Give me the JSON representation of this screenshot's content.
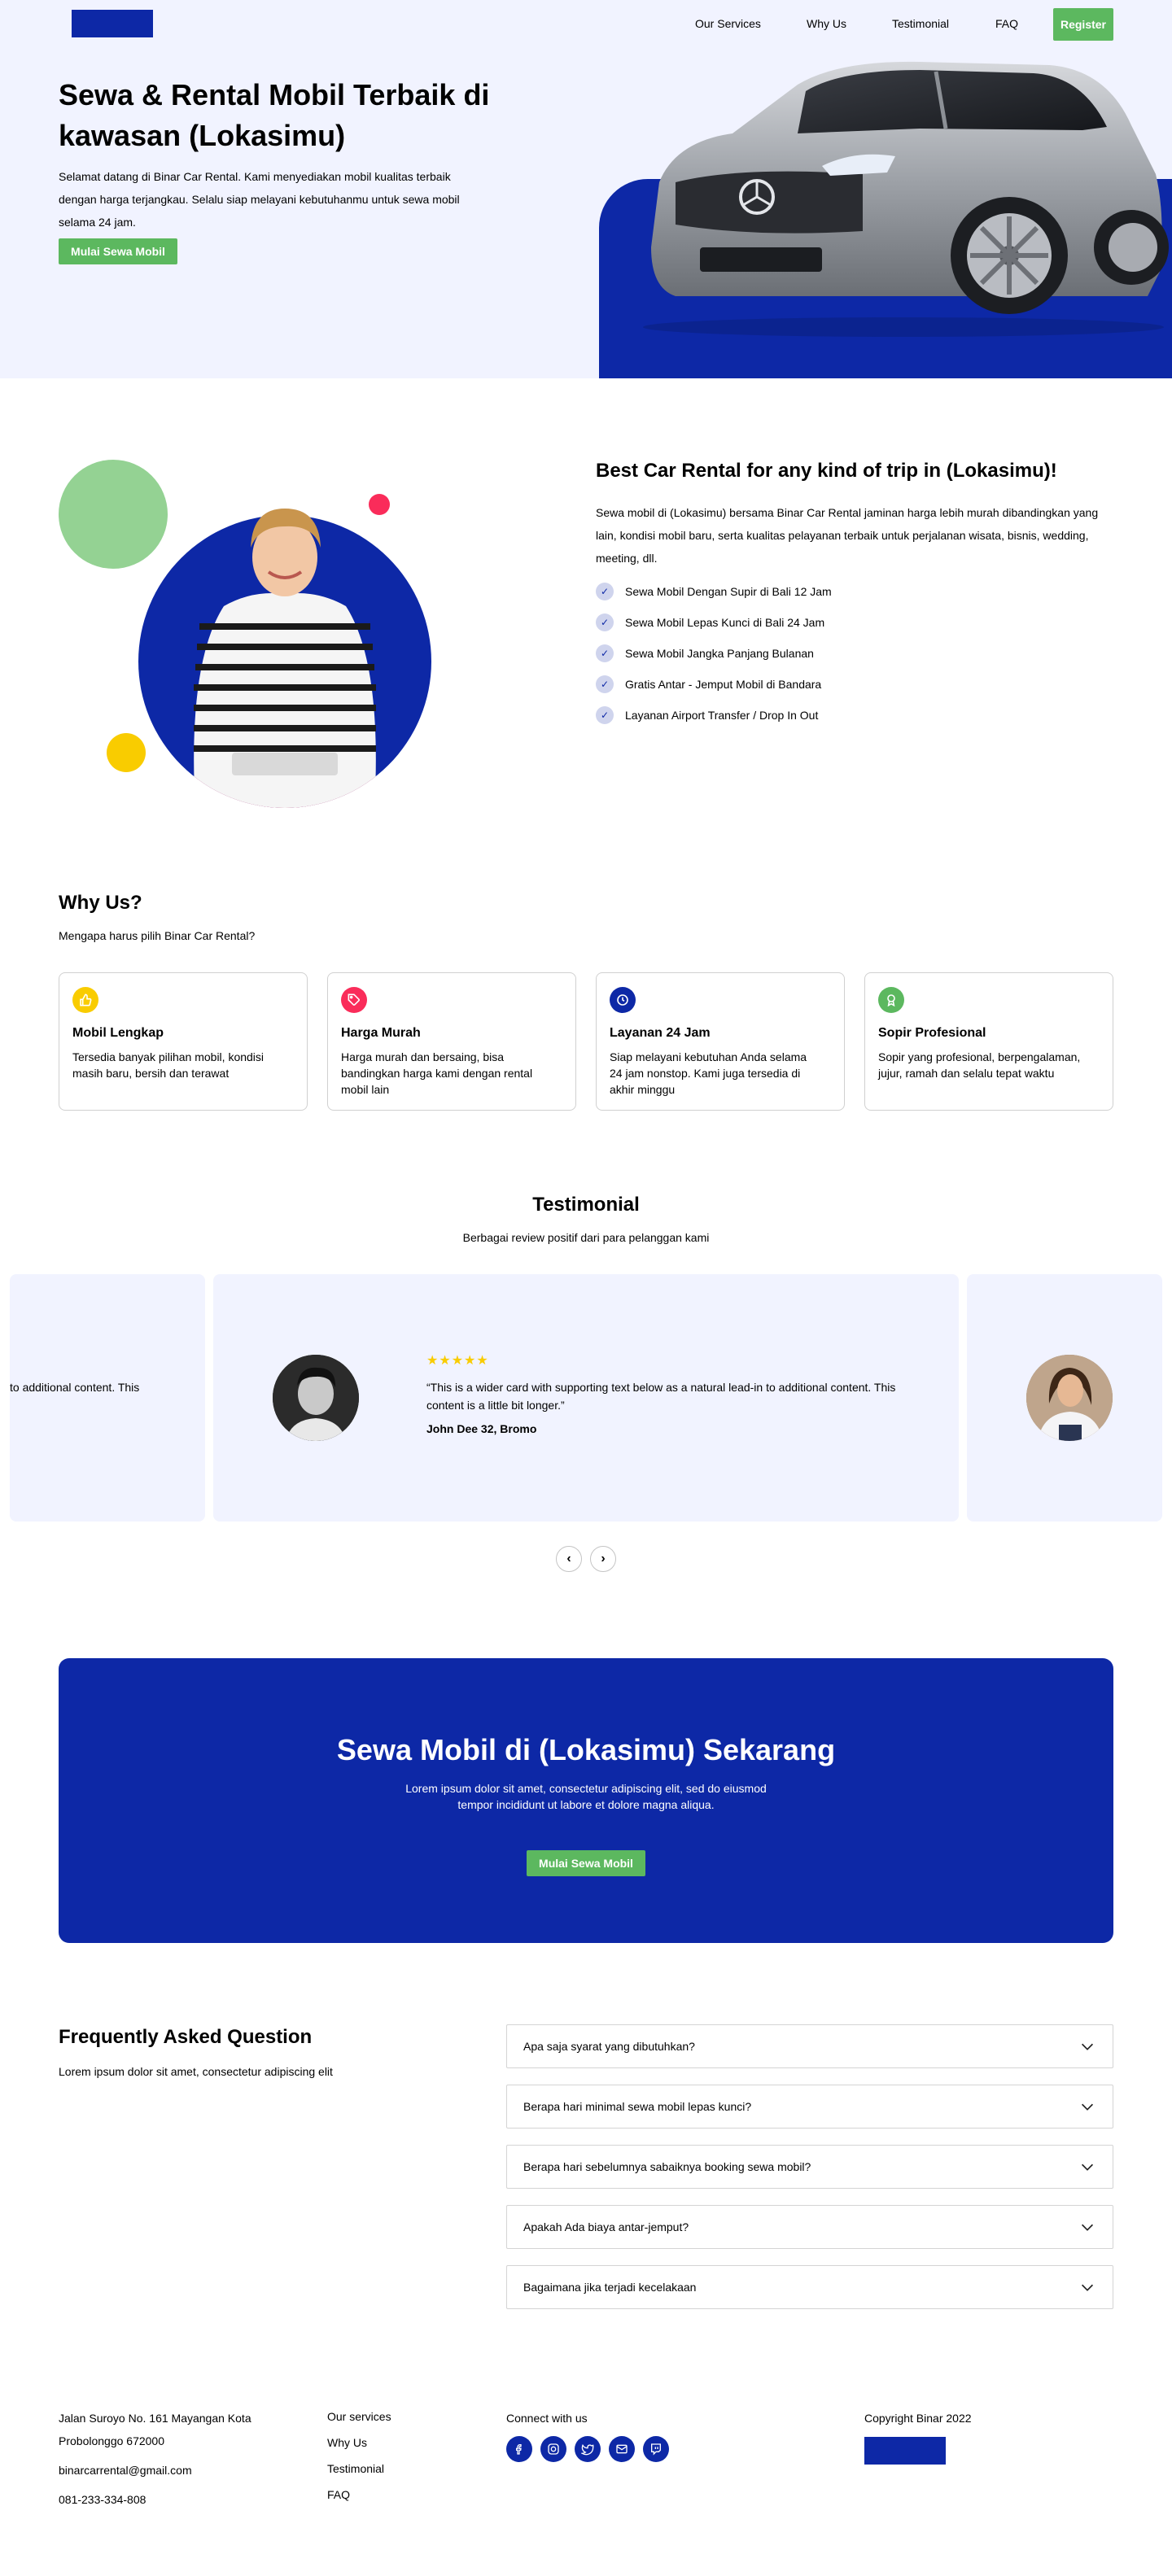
{
  "nav": {
    "links": [
      "Our Services",
      "Why Us",
      "Testimonial",
      "FAQ"
    ],
    "register": "Register"
  },
  "hero": {
    "title": "Sewa & Rental Mobil Terbaik di kawasan (Lokasimu)",
    "description": "Selamat datang di Binar Car Rental. Kami menyediakan mobil kualitas terbaik dengan harga terjangkau. Selalu siap melayani kebutuhanmu untuk sewa mobil selama 24 jam.",
    "cta": "Mulai Sewa Mobil"
  },
  "services": {
    "title": "Best Car Rental for any kind of trip in (Lokasimu)!",
    "description": "Sewa mobil di (Lokasimu) bersama Binar Car Rental jaminan harga lebih murah dibandingkan yang lain, kondisi mobil baru, serta kualitas pelayanan terbaik untuk perjalanan wisata, bisnis, wedding, meeting, dll.",
    "items": [
      "Sewa Mobil Dengan Supir di Bali 12 Jam",
      "Sewa Mobil Lepas Kunci di Bali 24 Jam",
      "Sewa Mobil Jangka Panjang Bulanan",
      "Gratis Antar - Jemput Mobil di Bandara",
      "Layanan Airport Transfer / Drop In Out"
    ]
  },
  "why": {
    "title": "Why Us?",
    "subtitle": "Mengapa harus pilih Binar Car Rental?",
    "cards": [
      {
        "icon": "thumbs-up-icon",
        "color": "#F9CC00",
        "title": "Mobil Lengkap",
        "desc": "Tersedia banyak pilihan mobil, kondisi masih baru, bersih dan terawat"
      },
      {
        "icon": "tag-icon",
        "color": "#FA2C5A",
        "title": "Harga Murah",
        "desc": "Harga murah dan bersaing, bisa bandingkan harga kami dengan rental mobil lain"
      },
      {
        "icon": "clock-icon",
        "color": "#0D28A6",
        "title": "Layanan 24 Jam",
        "desc": "Siap melayani kebutuhan Anda selama 24 jam nonstop. Kami juga tersedia di akhir minggu"
      },
      {
        "icon": "award-icon",
        "color": "#5CB85F",
        "title": "Sopir Profesional",
        "desc": "Sopir yang profesional, berpengalaman, jujur, ramah dan selalu tepat waktu"
      }
    ]
  },
  "testimonial": {
    "title": "Testimonial",
    "subtitle": "Berbagai review positif dari para pelanggan kami",
    "partial_left": "to additional content. This",
    "rating": "★★★★★",
    "quote": "“This is a wider card with supporting text below as a natural lead-in to additional content. This content is a little bit longer.”",
    "name": "John Dee 32, Bromo",
    "prev": "‹",
    "next": "›"
  },
  "cta": {
    "title": "Sewa Mobil di (Lokasimu) Sekarang",
    "description": "Lorem ipsum dolor sit amet, consectetur adipiscing elit, sed do eiusmod tempor incididunt ut labore et dolore magna aliqua.",
    "button": "Mulai Sewa Mobil"
  },
  "faq": {
    "title": "Frequently Asked Question",
    "subtitle": "Lorem ipsum dolor sit amet, consectetur adipiscing elit",
    "questions": [
      "Apa saja syarat yang dibutuhkan?",
      "Berapa hari minimal sewa mobil lepas kunci?",
      "Berapa hari sebelumnya sabaiknya booking sewa mobil?",
      "Apakah Ada biaya antar-jemput?",
      "Bagaimana jika terjadi kecelakaan"
    ]
  },
  "footer": {
    "address_line1": "Jalan Suroyo No. 161 Mayangan Kota",
    "address_line2": "Probolonggo 672000",
    "email": "binarcarrental@gmail.com",
    "phone": "081-233-334-808",
    "links": [
      "Our services",
      "Why Us",
      "Testimonial",
      "FAQ"
    ],
    "connect": "Connect with us",
    "social_icons": [
      "facebook-icon",
      "instagram-icon",
      "twitter-icon",
      "mail-icon",
      "twitch-icon"
    ],
    "copyright": "Copyright Binar 2022"
  },
  "colors": {
    "primary": "#0D28A6",
    "green": "#5CB85F",
    "hero_bg": "#F1F3FF",
    "yellow": "#F9CC00",
    "red": "#FA2C5A"
  }
}
